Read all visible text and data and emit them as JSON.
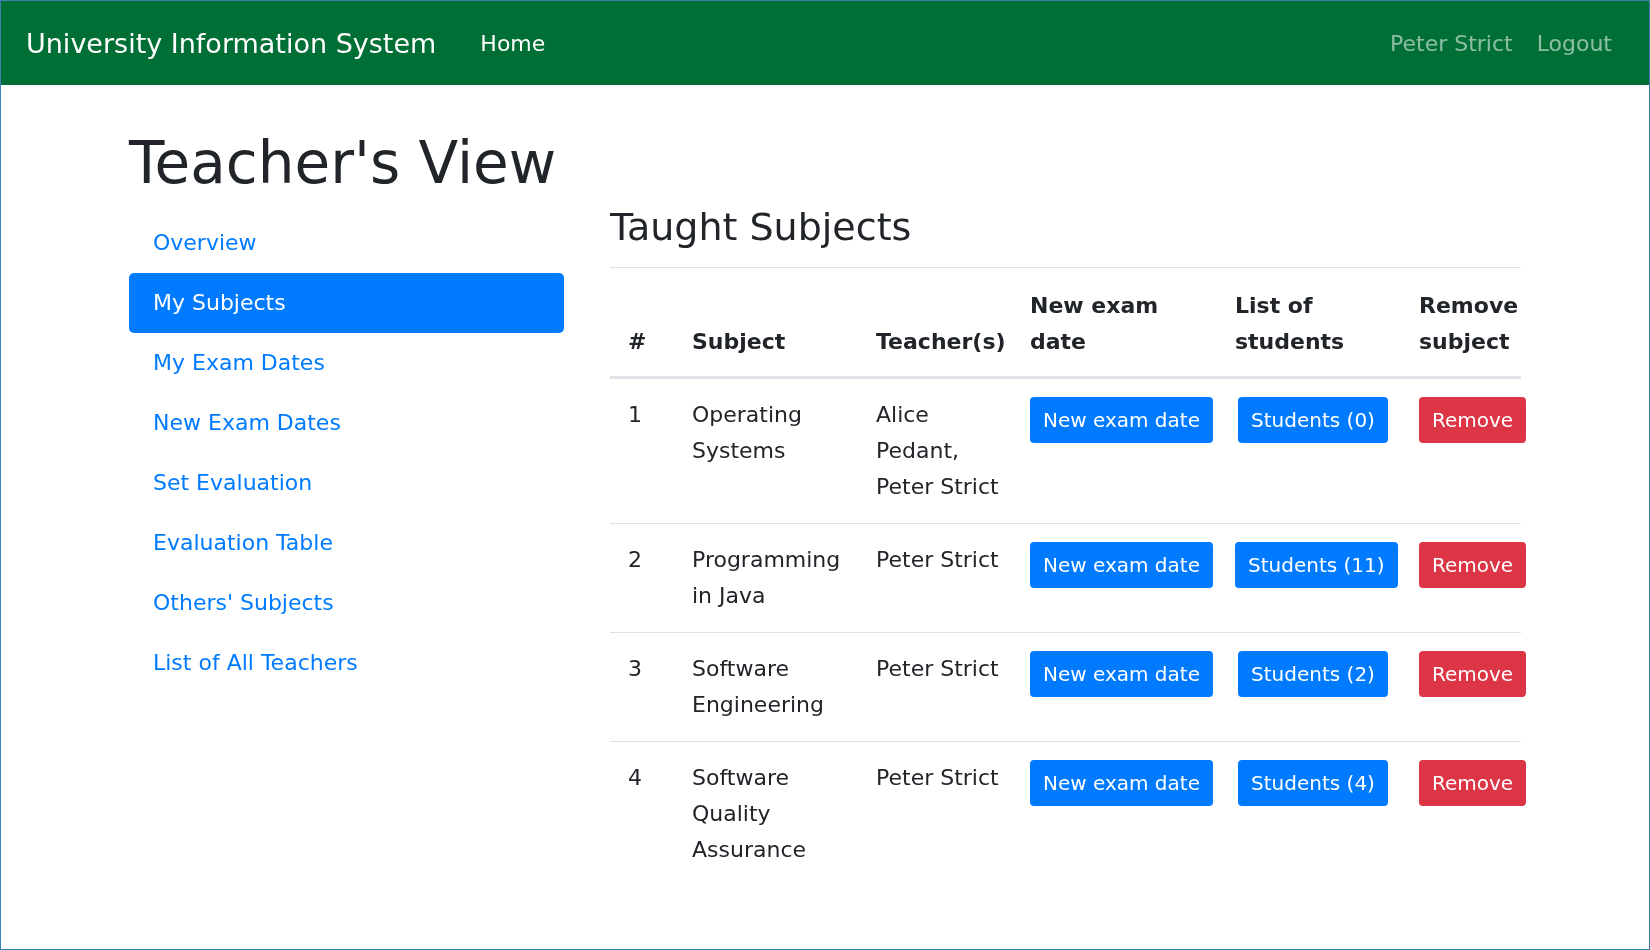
{
  "navbar": {
    "brand": "University Information System",
    "links": [
      {
        "label": "Home",
        "selected": true
      }
    ],
    "user": "Peter Strict",
    "logout": "Logout"
  },
  "page_title": "Teacher's View",
  "sidebar": {
    "items": [
      {
        "label": "Overview",
        "selected": false
      },
      {
        "label": "My Subjects",
        "selected": true
      },
      {
        "label": "My Exam Dates",
        "selected": false
      },
      {
        "label": "New Exam Dates",
        "selected": false
      },
      {
        "label": "Set Evaluation",
        "selected": false
      },
      {
        "label": "Evaluation Table",
        "selected": false
      },
      {
        "label": "Others' Subjects",
        "selected": false
      },
      {
        "label": "List of All Teachers",
        "selected": false
      }
    ]
  },
  "section_title": "Taught Subjects",
  "table": {
    "columns": [
      "#",
      "Subject",
      "Teacher(s)",
      "New exam date",
      "List of students",
      "Remove subject"
    ],
    "rows": [
      {
        "number": "1",
        "subject": "Operating Systems",
        "teachers": "Alice Pedant, Peter Strict",
        "new_exam": "New exam date",
        "students": "Students (0)",
        "remove": "Remove"
      },
      {
        "number": "2",
        "subject": "Programming in Java",
        "teachers": "Peter Strict",
        "new_exam": "New exam date",
        "students": "Students (11)",
        "remove": "Remove"
      },
      {
        "number": "3",
        "subject": "Software Engineering",
        "teachers": "Peter Strict",
        "new_exam": "New exam date",
        "students": "Students (2)",
        "remove": "Remove"
      },
      {
        "number": "4",
        "subject": "Software Quality Assurance",
        "teachers": "Peter Strict",
        "new_exam": "New exam date",
        "students": "Students (4)",
        "remove": "Remove"
      }
    ]
  }
}
